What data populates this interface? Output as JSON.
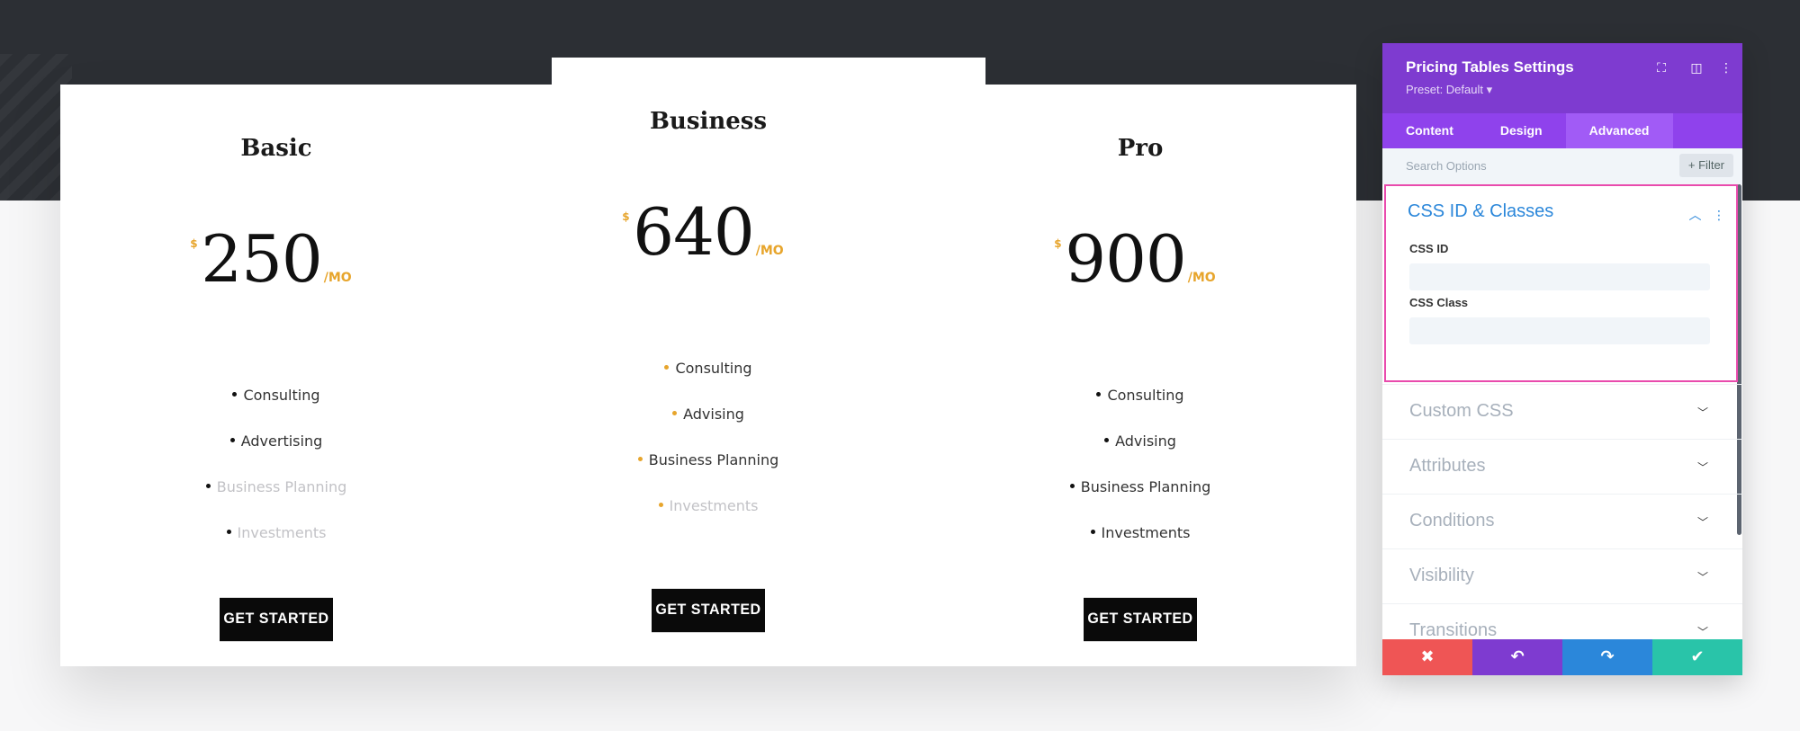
{
  "colors": {
    "hero_bg": "#2c2f34",
    "accent_gold": "#e7a52c",
    "panel_purple": "#7e3bd0",
    "tabs_purple": "#8f42ec",
    "link_blue": "#2b87da",
    "highlight_pink": "#e94bad",
    "footer": [
      "#ef5555",
      "#7e3bd0",
      "#2b87da",
      "#29c4a9"
    ]
  },
  "plans": [
    {
      "title": "Basic",
      "currency": "$",
      "amount": "250",
      "period": "/MO",
      "features": [
        {
          "label": "Consulting",
          "dim": false
        },
        {
          "label": "Advertising",
          "dim": false
        },
        {
          "label": "Business Planning",
          "dim": true
        },
        {
          "label": "Investments",
          "dim": true
        }
      ],
      "button": "GET STARTED"
    },
    {
      "title": "Business",
      "currency": "$",
      "amount": "640",
      "period": "/MO",
      "features": [
        {
          "label": "Consulting",
          "dim": false
        },
        {
          "label": "Advising",
          "dim": false
        },
        {
          "label": "Business Planning",
          "dim": false
        },
        {
          "label": "Investments",
          "dim": true
        }
      ],
      "button": "GET STARTED"
    },
    {
      "title": "Pro",
      "currency": "$",
      "amount": "900",
      "period": "/MO",
      "features": [
        {
          "label": "Consulting",
          "dim": false
        },
        {
          "label": "Advising",
          "dim": false
        },
        {
          "label": "Business Planning",
          "dim": false
        },
        {
          "label": "Investments",
          "dim": false
        }
      ],
      "button": "GET STARTED"
    }
  ],
  "panel": {
    "title": "Pricing Tables Settings",
    "preset": "Preset: Default ▾",
    "icons": [
      "expand-icon",
      "split-view-icon",
      "more-vertical-icon"
    ],
    "tabs": [
      "Content",
      "Design",
      "Advanced"
    ],
    "active_tab": "Advanced",
    "search_placeholder": "Search Options",
    "filter_label": "Filter",
    "open_section": {
      "title": "CSS ID & Classes",
      "fields": [
        {
          "label": "CSS ID",
          "value": ""
        },
        {
          "label": "CSS Class",
          "value": ""
        }
      ]
    },
    "sections": [
      "Custom CSS",
      "Attributes",
      "Conditions",
      "Visibility",
      "Transitions"
    ],
    "footer_buttons": [
      {
        "name": "discard-button",
        "icon": "close-icon",
        "glyph": "✖"
      },
      {
        "name": "undo-button",
        "icon": "undo-icon",
        "glyph": "↶"
      },
      {
        "name": "redo-button",
        "icon": "redo-icon",
        "glyph": "↷"
      },
      {
        "name": "save-button",
        "icon": "check-icon",
        "glyph": "✔"
      }
    ]
  }
}
